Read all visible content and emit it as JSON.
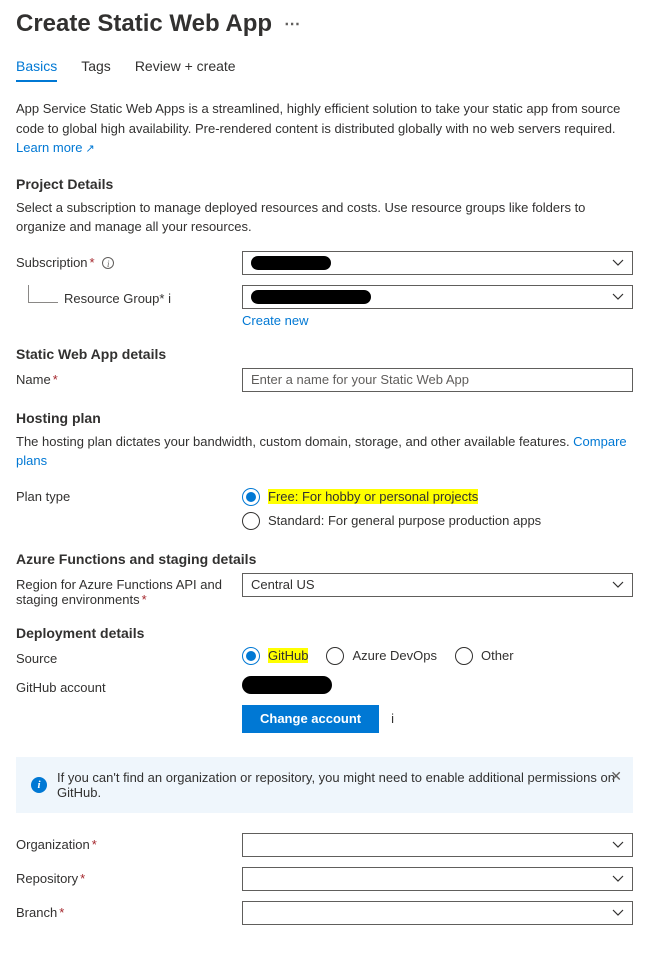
{
  "header": {
    "title": "Create Static Web App"
  },
  "tabs": {
    "basics": "Basics",
    "tags": "Tags",
    "review": "Review + create"
  },
  "intro": {
    "text": "App Service Static Web Apps is a streamlined, highly efficient solution to take your static app from source code to global high availability. Pre-rendered content is distributed globally with no web servers required.  ",
    "learn_more": "Learn more"
  },
  "project": {
    "heading": "Project Details",
    "desc": "Select a subscription to manage deployed resources and costs. Use resource groups like folders to organize and manage all your resources.",
    "subscription_label": "Subscription",
    "resource_group_label": "Resource Group",
    "create_new": "Create new"
  },
  "swa": {
    "heading": "Static Web App details",
    "name_label": "Name",
    "name_placeholder": "Enter a name for your Static Web App"
  },
  "hosting": {
    "heading": "Hosting plan",
    "desc": "The hosting plan dictates your bandwidth, custom domain, storage, and other available features. ",
    "compare": "Compare plans",
    "plan_type_label": "Plan type",
    "free_label": "Free: For hobby or personal projects",
    "standard_label": "Standard: For general purpose production apps"
  },
  "functions": {
    "heading": "Azure Functions and staging details",
    "region_label": "Region for Azure Functions API and staging environments",
    "region_value": "Central US"
  },
  "deploy": {
    "heading": "Deployment details",
    "source_label": "Source",
    "src_github": "GitHub",
    "src_ado": "Azure DevOps",
    "src_other": "Other",
    "account_label": "GitHub account",
    "change_account": "Change account"
  },
  "banner": {
    "text": "If you can't find an organization or repository, you might need to enable additional permissions on GitHub."
  },
  "repo": {
    "org_label": "Organization",
    "repo_label": "Repository",
    "branch_label": "Branch"
  }
}
